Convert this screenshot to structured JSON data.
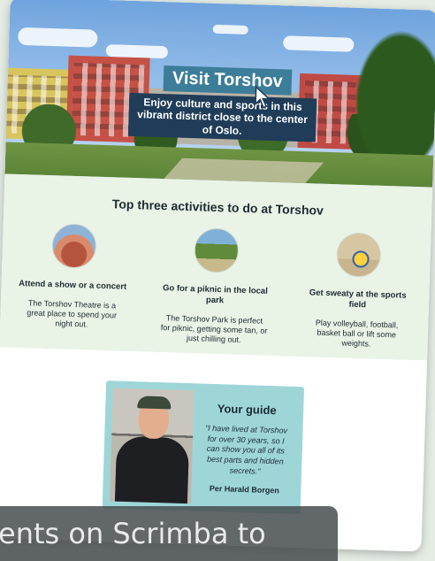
{
  "hero": {
    "title": "Visit Torshov",
    "subtitle": "Enjoy culture and sports in this vibrant district close to the center of Oslo."
  },
  "activities": {
    "heading": "Top three activities to do at Torshov",
    "items": [
      {
        "title": "Attend a show or a concert",
        "description": "The Torshov Theatre is a great place to spend your night out.",
        "image_icon": "theatre-image"
      },
      {
        "title": "Go for a piknic in the local park",
        "description": "The Torshov Park is perfect for piknic, getting some tan, or just chilling out.",
        "image_icon": "park-image"
      },
      {
        "title": "Get sweaty at the sports field",
        "description": "Play volleyball, football, basket ball or lift some weights.",
        "image_icon": "volleyball-image"
      }
    ]
  },
  "guide": {
    "heading": "Your guide",
    "quote": "\"I have lived at Torshov for over 30 years, so I can show you all of its best parts and hidden secrets.\"",
    "name": "Per Harald Borgen"
  },
  "overlay": {
    "caption": "ents on Scrimba to"
  },
  "colors": {
    "title_bg": "#3c7d99",
    "subtitle_bg": "#1f3c58",
    "activities_bg": "#e9f3e6",
    "guide_card_bg": "#9ed6d8",
    "page_bg": "#e4ece4"
  }
}
